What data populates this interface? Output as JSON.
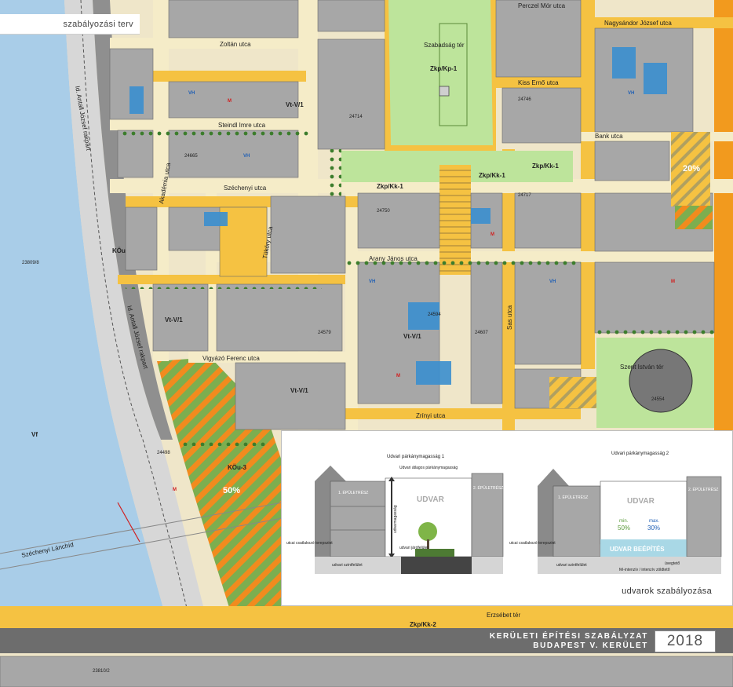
{
  "header": {
    "label": "szabályozási terv"
  },
  "map": {
    "streets": {
      "zoltan": "Zoltán utca",
      "steindl": "Steindl Imre utca",
      "szechenyi": "Széchenyi utca",
      "akademia": "Akadémia utca",
      "tukory": "Tüköry utca",
      "arany": "Arany János utca",
      "vigyazo": "Vigyázó Ferenc utca",
      "zrinyi": "Zrínyi utca",
      "sas": "Sas utca",
      "bank": "Bank utca",
      "kiss": "Kiss Ernő utca",
      "perczel": "Perczel Mór utca",
      "nagysandor": "Nagysándor József utca",
      "erzsebet": "Erzsébet tér",
      "antall1": "Id. Antall József rakpart",
      "antall2": "Id. Antall József rakpart",
      "lanchid": "Széchenyi Lánchíd",
      "szabadsag": "Szabadság tér",
      "szentistvan": "Szent István tér"
    },
    "zones": {
      "zkp1": "Zkp/Kp-1",
      "zkpkk1a": "Zkp/Kk-1",
      "zkpkk1b": "Zkp/Kk-1",
      "zkpkk1c": "Zkp/Kk-1",
      "zkpkk2": "Zkp/Kk-2",
      "kou3": "KÖu-3",
      "kou": "KÖu",
      "vf": "Vf",
      "pct50": "50%",
      "pct20": "20%",
      "vt1": "Vt-V/1",
      "vt1b": "Vt-V/1",
      "vt1c": "Vt-V/1",
      "vt1d": "Vt-V/1"
    },
    "parcels": {
      "p1": "24714",
      "p2": "24717",
      "p3": "24746",
      "p4": "24750",
      "p5": "24594",
      "p6": "24554",
      "p7": "24665",
      "p8": "24498",
      "p9": "23809/8",
      "p10": "23810/2",
      "p11": "24579",
      "p12": "24607"
    },
    "marks": {
      "vh": "VH",
      "m": "M"
    }
  },
  "inset": {
    "caption": "udvarok szabályozása",
    "left": {
      "top_label": "Udvari párkánymagasság 1",
      "sub_label": "Udvari átlagos párkánymagasság",
      "wing1": "1. ÉPÜLETRÉSZ",
      "wing2": "2. ÉPÜLETRÉSZ",
      "courtyard": "UDVAR",
      "height_label": "udvarmagasság",
      "street_level": "utcai csatlakozó terepszint",
      "floor_level": "udvari járófelület",
      "ground_level": "udvari szintfelület"
    },
    "right": {
      "top_label": "Udvari párkánymagasság 2",
      "wing1": "1. ÉPÜLETRÉSZ",
      "wing2": "2. ÉPÜLETRÉSZ",
      "courtyard": "UDVAR",
      "min_label": "min.",
      "min_value": "50%",
      "max_label": "max.",
      "max_value": "30%",
      "built_label": "UDVAR BEÉPÍTÉS",
      "glass_label": "üvegtető",
      "street_level": "utcai csatlakozó terepszint",
      "floor_level": "udvari szintfelület",
      "under_label": "fél-intenzív / intenzív zöldtető"
    }
  },
  "title": {
    "line1": "KERÜLETI ÉPÍTÉSI SZABÁLYZAT",
    "line2": "BUDAPEST  V. KERÜLET",
    "year": "2018"
  },
  "colors": {
    "river": "#a9cde8",
    "block": "#a7a7a7",
    "street": "#f5ecc8",
    "square": "#bde49b",
    "yellow": "#f5c242",
    "orange": "#f29a1e",
    "title_bar": "#6d6d6d",
    "vh_blue": "#1f5fb5",
    "m_red": "#d11f1f"
  }
}
